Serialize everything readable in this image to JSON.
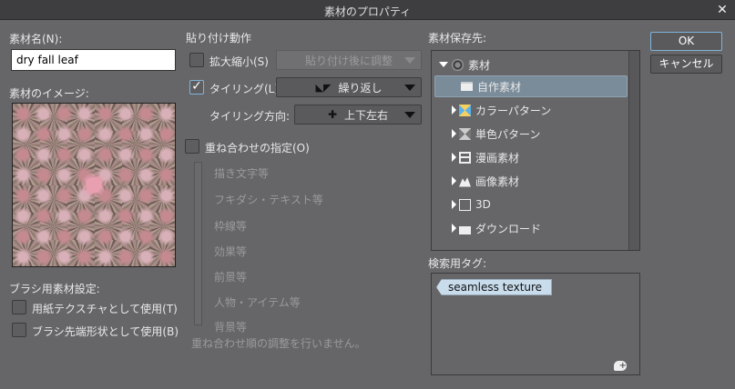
{
  "window": {
    "title": "素材のプロパティ",
    "close_icon": "close-icon"
  },
  "left": {
    "name_label": "素材名(N):",
    "name_value": "dry fall leaf",
    "image_label": "素材のイメージ:",
    "brush_label": "ブラシ用素材設定:",
    "paper_texture": "用紙テクスチャとして使用(T)",
    "brush_tip": "ブラシ先端形状として使用(B)"
  },
  "paste": {
    "title": "貼り付け動作",
    "scale_label": "拡大縮小(S)",
    "scale_checked": false,
    "scale_option": "貼り付け後に調整",
    "tiling_label": "タイリング(L)",
    "tiling_checked": true,
    "tiling_option": "繰り返し",
    "direction_label": "タイリング方向:",
    "direction_option": "上下左右"
  },
  "overlay": {
    "label": "重ね合わせの指定(O)",
    "checked": false,
    "items": [
      "描き文字等",
      "フキダシ・テキスト等",
      "枠線等",
      "効果等",
      "前景等",
      "人物・アイテム等",
      "背景等"
    ],
    "note": "重ね合わせ順の調整を行いません。"
  },
  "storage": {
    "label": "素材保存先:",
    "tree": [
      {
        "label": "素材",
        "icon": "material-root-icon",
        "expanded": true,
        "level": 0
      },
      {
        "label": "自作素材",
        "icon": "folder-icon",
        "selected": true,
        "level": 1
      },
      {
        "label": "カラーパターン",
        "icon": "color-pattern-icon",
        "level": 1
      },
      {
        "label": "単色パターン",
        "icon": "mono-pattern-icon",
        "level": 1
      },
      {
        "label": "漫画素材",
        "icon": "manga-material-icon",
        "level": 1
      },
      {
        "label": "画像素材",
        "icon": "image-material-icon",
        "level": 1
      },
      {
        "label": "3D",
        "icon": "3d-cube-icon",
        "level": 1
      },
      {
        "label": "ダウンロード",
        "icon": "download-icon",
        "level": 1
      }
    ]
  },
  "tags": {
    "label": "検索用タグ:",
    "items": [
      "seamless texture"
    ],
    "add_icon": "add-tag-icon"
  },
  "buttons": {
    "ok": "OK",
    "cancel": "キャンセル"
  },
  "colors": {
    "background": "#666669",
    "selection": "#7a8c9a",
    "focus": "#7fb3d8",
    "tag": "#c8dcec"
  }
}
